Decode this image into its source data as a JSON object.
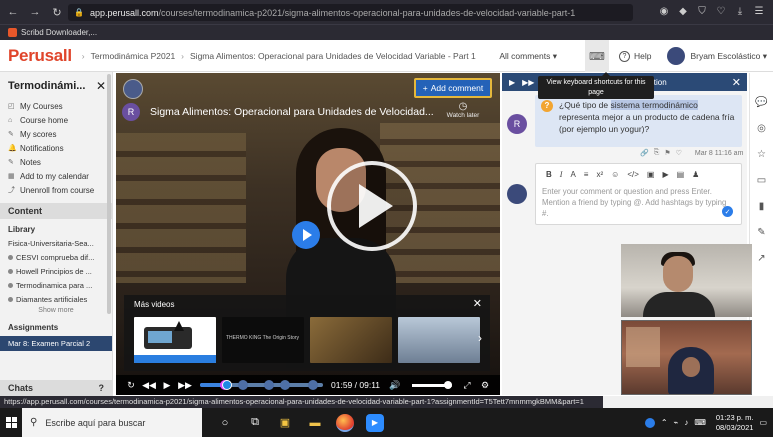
{
  "browser": {
    "url_host": "app.perusall.com",
    "url_path": "/courses/termodinamica-p2021/sigma-alimentos-operacional-para-unidades-de-velocidad-variable-part-1",
    "bookmark": "Scribd Downloader,..."
  },
  "header": {
    "logo": "Perusall",
    "breadcrumb": [
      "Termodinámica P2021",
      "Sigma Alimentos: Operacional para Unidades de Velocidad Variable - Part 1"
    ],
    "all_comments": "All comments ▾",
    "help": "Help",
    "user": "Bryam Escolástico ▾"
  },
  "tooltip": "View keyboard shortcuts for this page",
  "sidebar": {
    "course": "Termodinámi...",
    "menu": [
      {
        "icon": "◰",
        "label": "My Courses"
      },
      {
        "icon": "⌂",
        "label": "Course home"
      },
      {
        "icon": "✎",
        "label": "My scores"
      },
      {
        "icon": "🔔",
        "label": "Notifications"
      },
      {
        "icon": "✎",
        "label": "Notes"
      },
      {
        "icon": "▦",
        "label": "Add to my calendar"
      },
      {
        "icon": "⤴",
        "label": "Unenroll from course"
      }
    ],
    "content_label": "Content",
    "library_label": "Library",
    "library": [
      "Fisica-Universitaria-Sea...",
      "CESVI comprueba dif...",
      "Howell Principios de ...",
      "Termodinamica para ...",
      "Diamantes artificiales"
    ],
    "show_more": "Show more",
    "assignments_label": "Assignments",
    "assignment_active": "Mar 8: Examen Parcial 2",
    "chats_label": "Chats"
  },
  "video": {
    "title": "Sigma Alimentos: Operacional para Unidades de Velocidad...",
    "watch_later": "Watch later",
    "add_comment": "Add comment",
    "avatar_letter": "R",
    "more_videos": "Más videos",
    "thumb2_text": "THERMO KING  The Origin Story",
    "current_time": "01:59",
    "total_time": "09:11",
    "progress": 0.216,
    "volume": 0.9
  },
  "comments": {
    "question_before": "¿Qué tipo de ",
    "question_highlight": "sistema termodinámico",
    "question_after": " representa mejor a un producto de cadena fría (por ejemplo un yogur)?",
    "author_letter": "R",
    "date": "Mar 8 11:16 am",
    "editor_placeholder": "Enter your comment or question and press Enter. Mention a friend by typing @. Add hashtags by typing #.",
    "head_label": "ition"
  },
  "status_url": "https://app.perusall.com/courses/termodinamica-p2021/sigma-alimentos-operacional-para-unidades-de-velocidad-variable-part-1?assignmentId=T5Tett7mnmmgkBMM&part=1",
  "taskbar": {
    "search_placeholder": "Escribe aquí para buscar",
    "time": "01:23 p. m.",
    "date": "08/03/2021"
  }
}
